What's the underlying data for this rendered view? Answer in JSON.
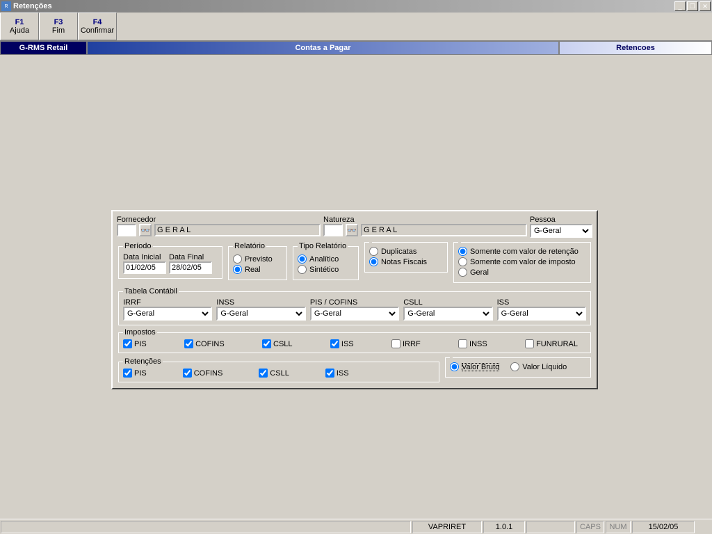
{
  "window": {
    "title": "Retenções"
  },
  "toolbar": {
    "f1_key": "F1",
    "f1_label": "Ajuda",
    "f3_key": "F3",
    "f3_label": "Fim",
    "f4_key": "F4",
    "f4_label": "Confirmar"
  },
  "breadcrumb": {
    "app": "G-RMS Retail",
    "module": "Contas a Pagar",
    "page": "Retencoes"
  },
  "fornecedor": {
    "label": "Fornecedor",
    "code": "",
    "name": "G E R A L"
  },
  "natureza": {
    "label": "Natureza",
    "code": "",
    "name": "G E R A L"
  },
  "pessoa": {
    "label": "Pessoa",
    "value": "G-Geral"
  },
  "periodo": {
    "legend": "Período",
    "data_inicial_label": "Data Inicial",
    "data_inicial": "01/02/05",
    "data_final_label": "Data Final",
    "data_final": "28/02/05"
  },
  "relatorio": {
    "legend": "Relatório",
    "previsto": "Previsto",
    "real": "Real"
  },
  "tipo_relatorio": {
    "legend": "Tipo Relatório",
    "analitico": "Analítico",
    "sintetico": "Sintético"
  },
  "origem": {
    "duplicatas": "Duplicatas",
    "notas_fiscais": "Notas Fiscais"
  },
  "filtro": {
    "retencao": "Somente com valor de retenção",
    "imposto": "Somente com valor de imposto",
    "geral": "Geral"
  },
  "tabela_contabil": {
    "legend": "Tabela Contábil",
    "irrf_label": "IRRF",
    "irrf": "G-Geral",
    "inss_label": "INSS",
    "inss": "G-Geral",
    "piscofins_label": "PIS / COFINS",
    "piscofins": "G-Geral",
    "csll_label": "CSLL",
    "csll": "G-Geral",
    "iss_label": "ISS",
    "iss": "G-Geral"
  },
  "impostos": {
    "legend": "Impostos",
    "pis": "PIS",
    "cofins": "COFINS",
    "csll": "CSLL",
    "iss": "ISS",
    "irrf": "IRRF",
    "inss": "INSS",
    "funrural": "FUNRURAL"
  },
  "retencoes": {
    "legend": "Retenções",
    "pis": "PIS",
    "cofins": "COFINS",
    "csll": "CSLL",
    "iss": "ISS",
    "valor_bruto": "Valor Bruto",
    "valor_liquido": "Valor Líquido"
  },
  "statusbar": {
    "program": "VAPRIRET",
    "version": "1.0.1",
    "caps": "CAPS",
    "num": "NUM",
    "date": "15/02/05"
  }
}
